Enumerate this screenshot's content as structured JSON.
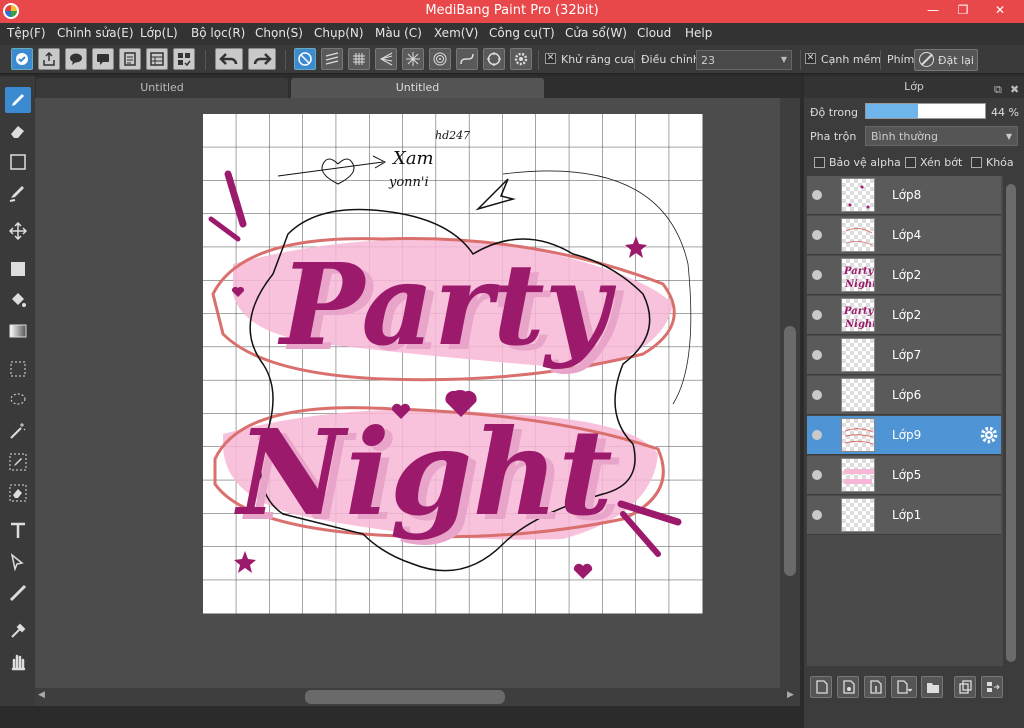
{
  "window": {
    "title": "MediBang Paint Pro (32bit)",
    "minimize_icon": "minimize-icon",
    "maximize_icon": "restore-icon",
    "close_icon": "close-icon",
    "close_glyph": "✕",
    "min_glyph": "—",
    "restore_glyph": "❐"
  },
  "menu": [
    "Tệp(F)",
    "Chỉnh sửa(E)",
    "Lớp(L)",
    "Bộ lọc(R)",
    "Chọn(S)",
    "Chụp(N)",
    "Màu (C)",
    "Xem(V)",
    "Công cụ(T)",
    "Cửa sổ(W)",
    "Cloud",
    "Help"
  ],
  "toolbar": {
    "antialias_label": "Khử răng cưa",
    "antialias_checked": true,
    "adjust_label": "Điều chỉnh",
    "adjust_value": "23",
    "soft_edge_label": "Cạnh mềm",
    "soft_edge_checked": true,
    "shortcut_label": "Phím",
    "reset_label": "Đặt lại"
  },
  "tabs": [
    {
      "label": "Untitled",
      "active": false
    },
    {
      "label": "Untitled",
      "active": true
    }
  ],
  "artwork": {
    "line1": "Party",
    "line2": "Night",
    "scribble1": "Xam",
    "scribble2": "yonn'i",
    "scribble3": "hd247"
  },
  "layer_panel": {
    "title": "Lớp",
    "opacity_label": "Độ trong",
    "opacity_value": "44 %",
    "opacity_fraction": 0.44,
    "blend_label": "Pha trộn",
    "blend_value": "Bình thường",
    "protect_alpha_label": "Bảo vệ alpha",
    "clip_label": "Xén bớt",
    "lock_label": "Khóa",
    "layers": [
      {
        "name": "Lớp8",
        "selected": false
      },
      {
        "name": "Lớp4",
        "selected": false
      },
      {
        "name": "Lớp2",
        "selected": false
      },
      {
        "name": "Lớp2",
        "selected": false
      },
      {
        "name": "Lớp7",
        "selected": false
      },
      {
        "name": "Lớp6",
        "selected": false
      },
      {
        "name": "Lớp9",
        "selected": true
      },
      {
        "name": "Lớp5",
        "selected": false
      },
      {
        "name": "Lớp1",
        "selected": false
      }
    ]
  },
  "colors": {
    "title_bar": "#e8484a",
    "accent_blue": "#3c8bd1",
    "magenta": "#9c1a6c",
    "pink": "#f7b3d4",
    "salmon": "#d9706e"
  }
}
